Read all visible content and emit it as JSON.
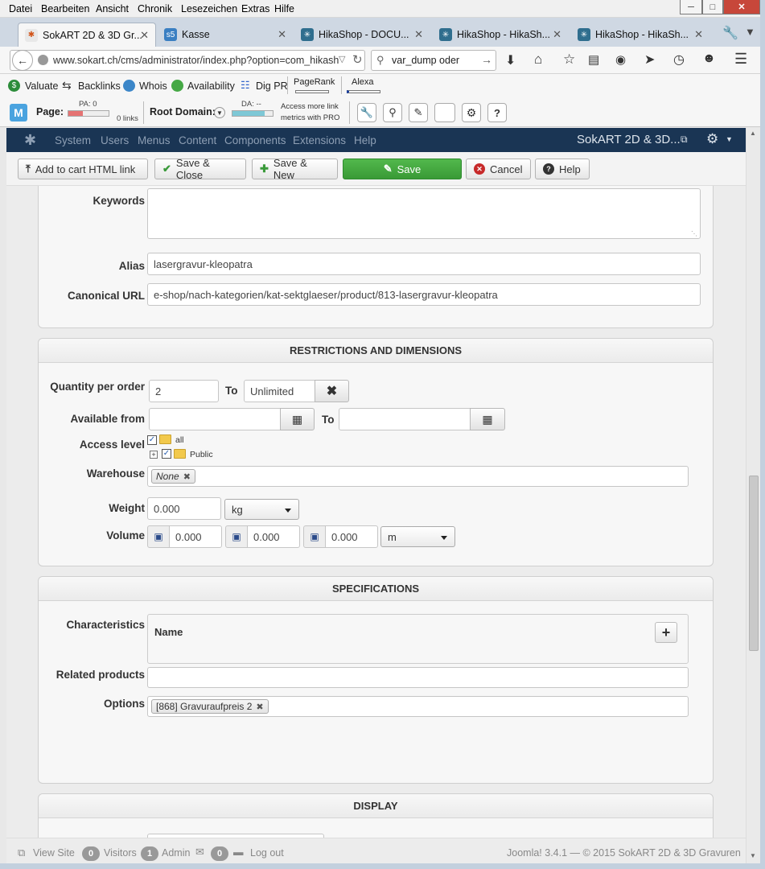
{
  "browser": {
    "menu": [
      "Datei",
      "Bearbeiten",
      "Ansicht",
      "Chronik",
      "Lesezeichen",
      "Extras",
      "Hilfe"
    ],
    "tabs": [
      {
        "label": "SokART 2D & 3D Gr...",
        "active": true
      },
      {
        "label": "Kasse",
        "active": false
      },
      {
        "label": "HikaShop - DOCU...",
        "active": false
      },
      {
        "label": "HikaShop - HikaSh...",
        "active": false
      },
      {
        "label": "HikaShop - HikaSh...",
        "active": false
      }
    ],
    "url": "www.sokart.ch/cms/administrator/index.php?option=com_hikash",
    "search_value": "var_dump oder"
  },
  "seo": {
    "valuate": "Valuate",
    "backlinks": "Backlinks",
    "whois": "Whois",
    "availability": "Availability",
    "digpr": "Dig PR",
    "pagerank": "PageRank",
    "alexa": "Alexa",
    "page_label": "Page:",
    "pa": "PA: 0",
    "links": "0 links",
    "root_label": "Root Domain:",
    "da": "DA: --",
    "access1": "Access more link",
    "access2": "metrics with PRO"
  },
  "joomla": {
    "nav": [
      "System",
      "Users",
      "Menus",
      "Content",
      "Components",
      "Extensions",
      "Help"
    ],
    "site": "SokART 2D & 3D..."
  },
  "toolbar": {
    "add_cart": "Add to cart HTML link",
    "save_close": "Save & Close",
    "save_new": "Save & New",
    "save": "Save",
    "cancel": "Cancel",
    "help": "Help"
  },
  "meta": {
    "keywords_label": "Keywords",
    "alias_label": "Alias",
    "alias_value": "lasergravur-kleopatra",
    "canonical_label": "Canonical URL",
    "canonical_value": "e-shop/nach-kategorien/kat-sektglaeser/product/813-lasergravur-kleopatra"
  },
  "restrictions": {
    "title": "RESTRICTIONS AND DIMENSIONS",
    "qty_label": "Quantity per order",
    "qty_min": "2",
    "to": "To",
    "qty_max": "Unlimited",
    "avail_label": "Available from",
    "access_label": "Access level",
    "access_all": "all",
    "access_public": "Public",
    "warehouse_label": "Warehouse",
    "warehouse_value": "None",
    "weight_label": "Weight",
    "weight_value": "0.000",
    "weight_unit": "kg",
    "volume_label": "Volume",
    "vol_x": "0.000",
    "vol_y": "0.000",
    "vol_z": "0.000",
    "vol_unit": "m"
  },
  "specs": {
    "title": "SPECIFICATIONS",
    "char_label": "Characteristics",
    "char_name": "Name",
    "related_label": "Related products",
    "options_label": "Options",
    "option_value": "[868] Gravuraufpreis 2"
  },
  "display": {
    "title": "DISPLAY"
  },
  "footer": {
    "view_site": "View Site",
    "visitors_count": "0",
    "visitors": "Visitors",
    "admin_count": "1",
    "admin": "Admin",
    "logout_count": "0",
    "logout": "Log out",
    "version": "Joomla! 3.4.1 — © 2015 SokART 2D & 3D Gravuren"
  },
  "colors": {
    "joomla_nav": "#1a3554",
    "save_green": "#3fa83b",
    "cancel_red": "#c72a2a"
  }
}
